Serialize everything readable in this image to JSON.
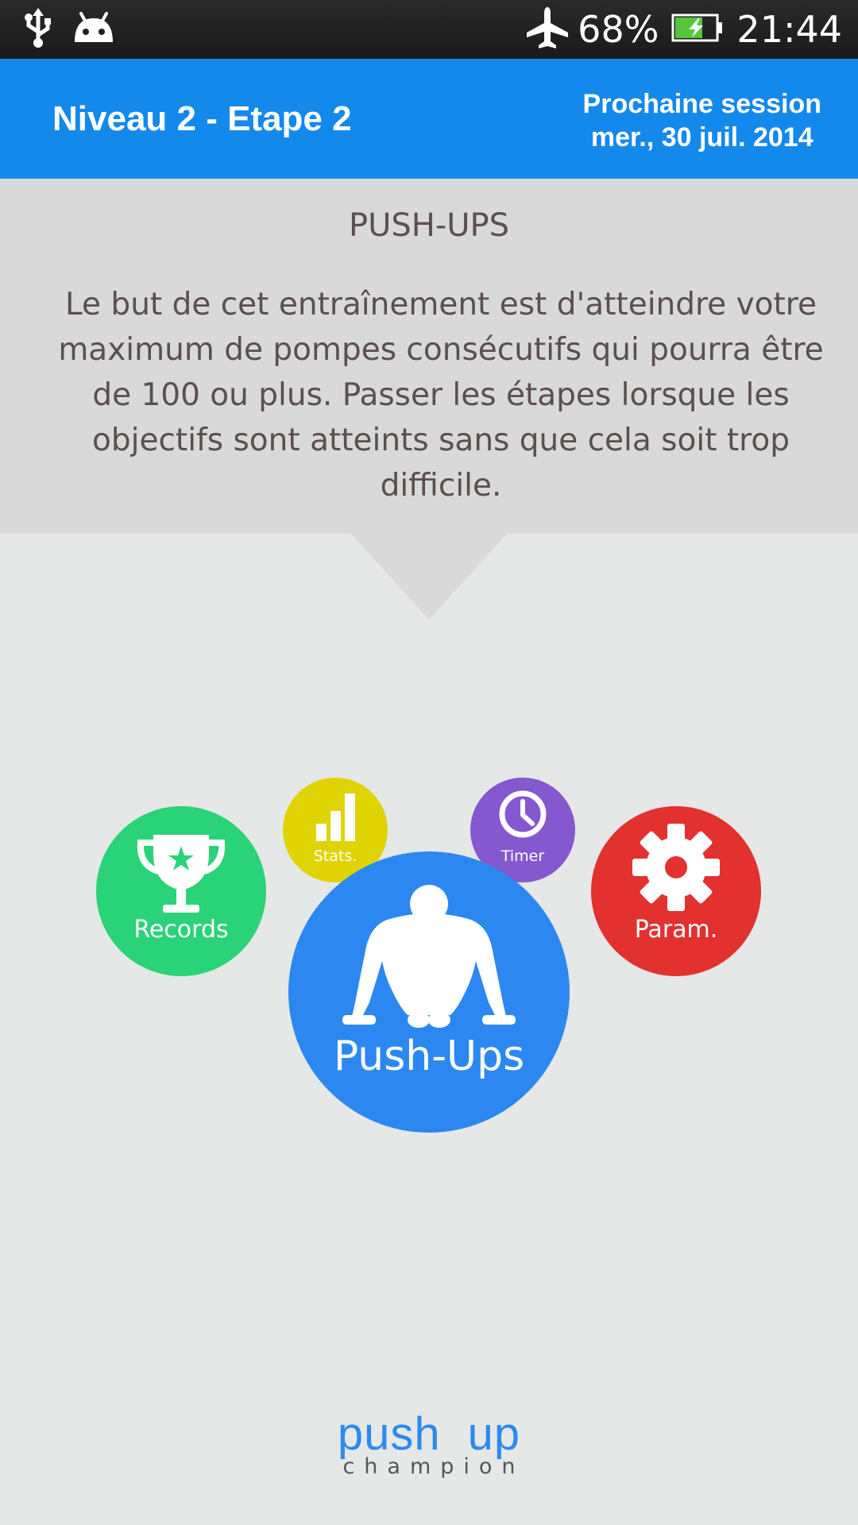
{
  "status_bar": {
    "battery_percent": "68%",
    "time": "21:44",
    "icons": [
      "usb-icon",
      "android-icon",
      "airplane-mode-icon",
      "battery-charging-icon"
    ],
    "battery_level": 0.68,
    "battery_color": "#55c63a"
  },
  "header": {
    "title": "Niveau 2 - Etape 2",
    "next_session_label": "Prochaine session",
    "next_session_date": "mer., 30 juil. 2014",
    "background_color": "#1489ec"
  },
  "description": {
    "title": "PUSH-UPS",
    "body": "Le but de cet entraînement est d'atteindre votre maximum de pompes consécutifs qui pourra être de 100 ou plus. Passer les étapes lorsque les objectifs sont atteints sans que cela soit trop difficile."
  },
  "menu": {
    "records": {
      "label": "Records",
      "icon": "trophy-icon",
      "color": "#2bd378"
    },
    "stats": {
      "label": "Stats.",
      "icon": "bar-chart-icon",
      "color": "#e0d304"
    },
    "timer": {
      "label": "Timer",
      "icon": "clock-icon",
      "color": "#8459cf"
    },
    "params": {
      "label": "Param.",
      "icon": "gear-icon",
      "color": "#e2312f"
    },
    "pushups": {
      "label": "Push-Ups",
      "icon": "push-up-athlete-icon",
      "color": "#2c88f0"
    }
  },
  "footer": {
    "logo_word1": "push",
    "logo_word2": "up",
    "logo_line2": "champion"
  }
}
